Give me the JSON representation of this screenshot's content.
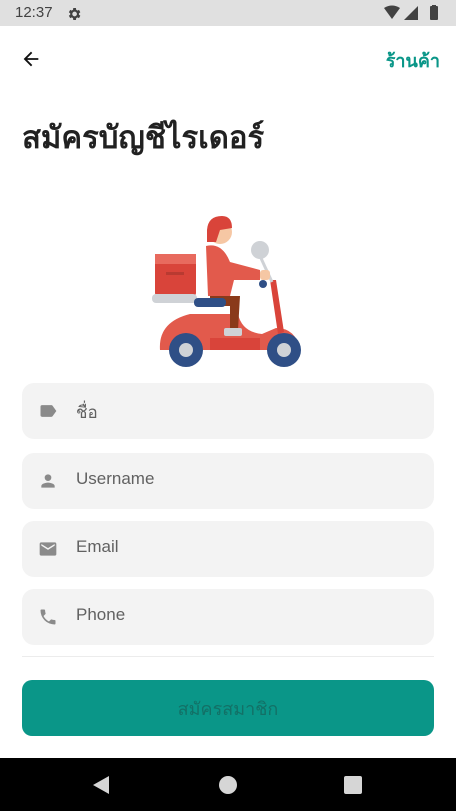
{
  "status_bar": {
    "time": "12:37",
    "icons": [
      "settings-icon",
      "wifi-icon",
      "signal-icon",
      "battery-icon"
    ]
  },
  "app_bar": {
    "back_icon": "arrow-back-icon",
    "shop_link": "ร้านค้า"
  },
  "page": {
    "title": "สมัครบัญชีไรเดอร์"
  },
  "form": {
    "name_placeholder": "ชื่อ",
    "username_placeholder": "Username",
    "email_placeholder": "Email",
    "phone_placeholder": "Phone",
    "submit_label": "สมัครสมาชิก"
  },
  "colors": {
    "accent": "#0a9688",
    "field_background": "#f3f3f3",
    "scooter_red": "#e25a4c"
  },
  "nav_bar": {
    "icons": [
      "nav-back-icon",
      "nav-home-icon",
      "nav-recents-icon"
    ]
  }
}
